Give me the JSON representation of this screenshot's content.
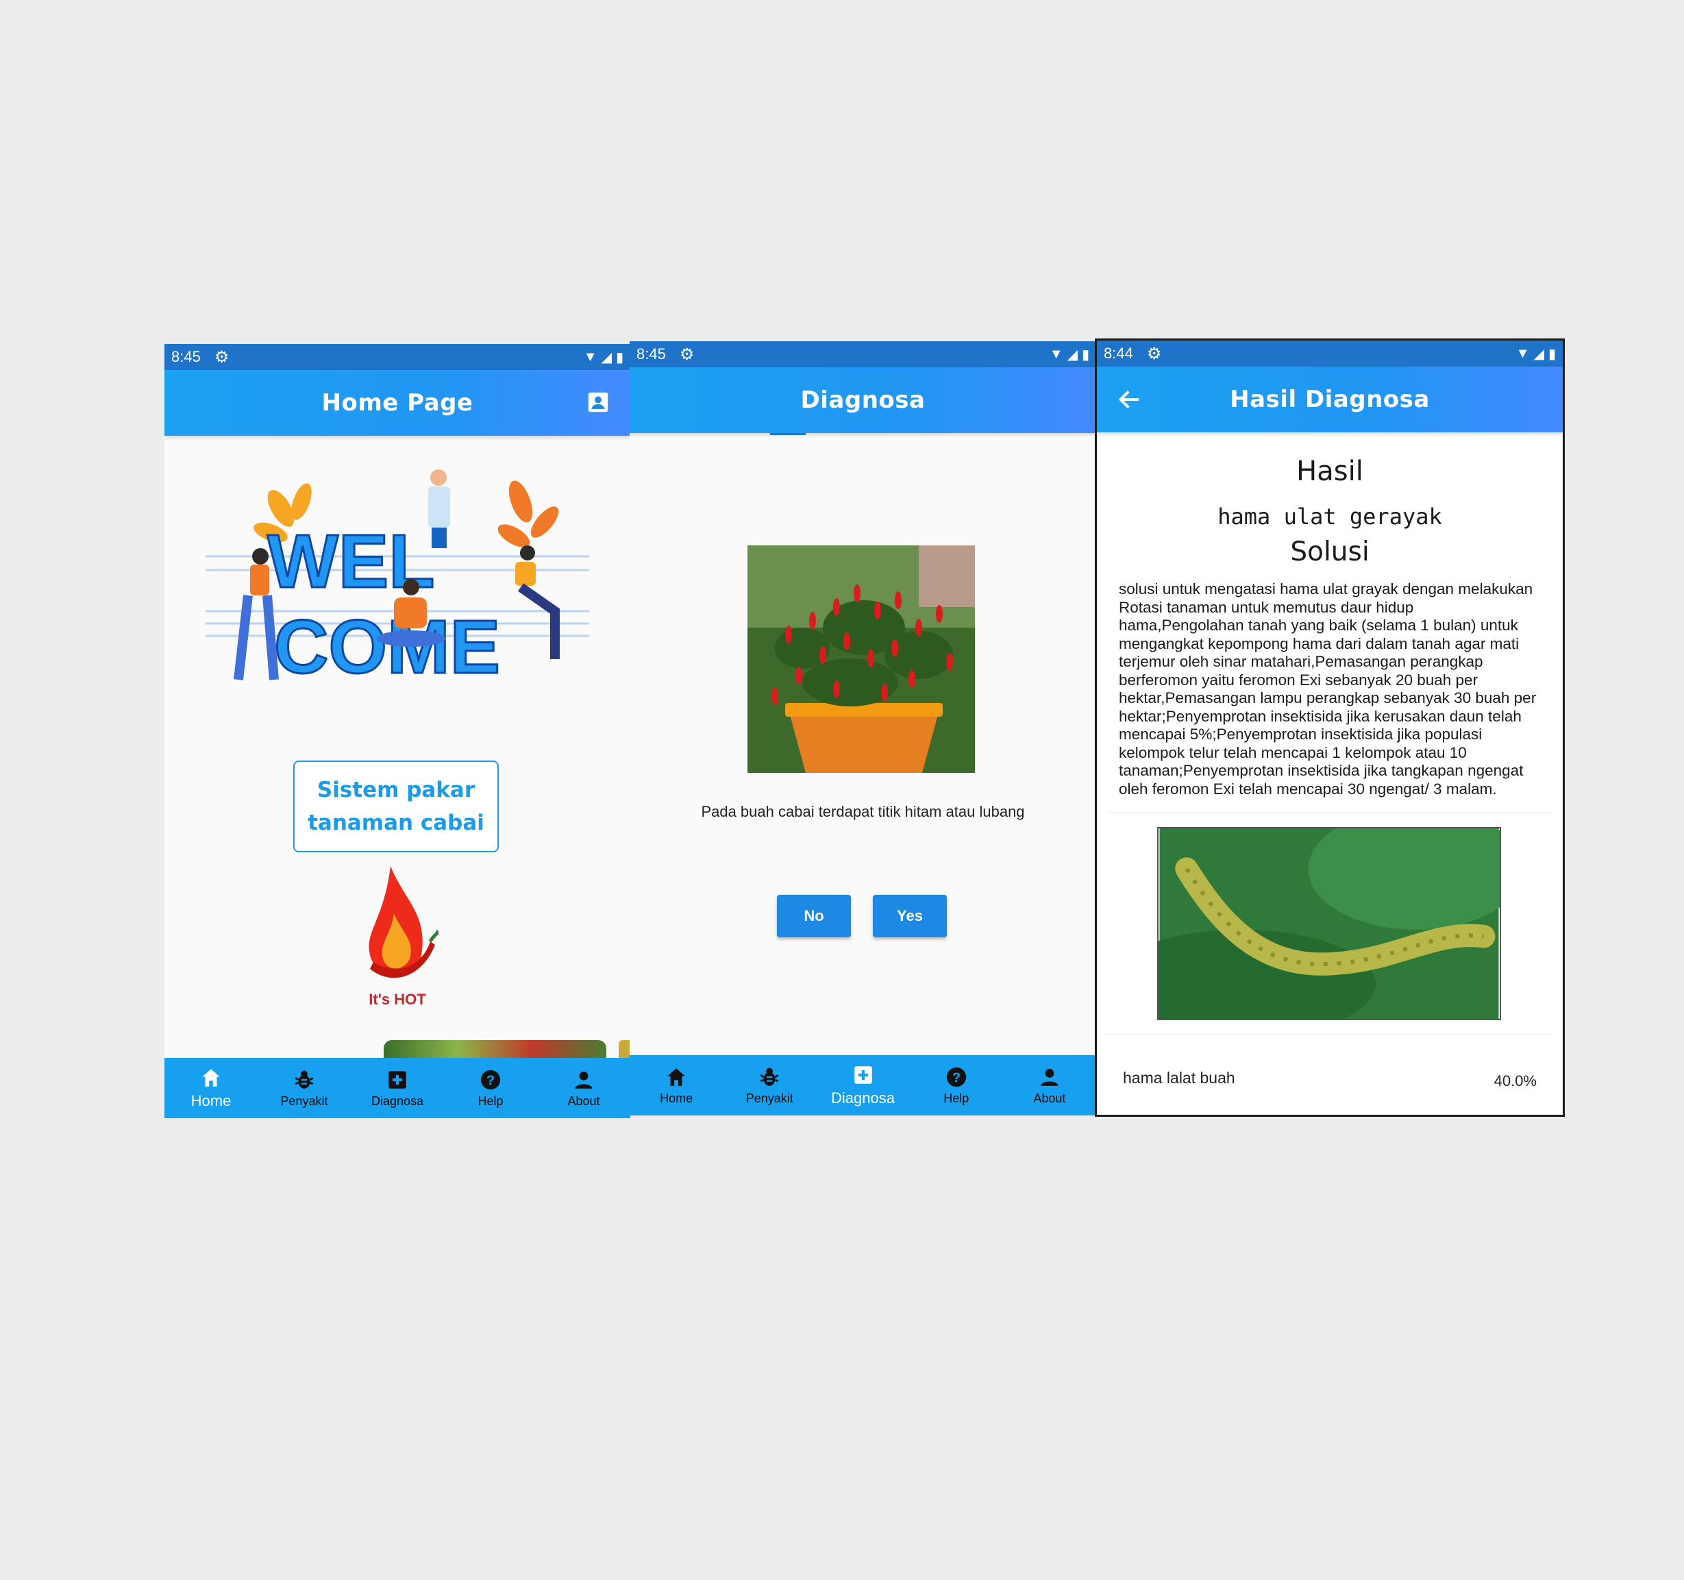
{
  "colors": {
    "appbar": "#2196f3",
    "statusbar": "#1f73c9",
    "navbar": "#18a0f0",
    "button": "#1e88e5",
    "accent_text": "#1b9be8"
  },
  "nav_items": [
    {
      "label": "Home",
      "icon": "home-icon"
    },
    {
      "label": "Penyakit",
      "icon": "bug-icon"
    },
    {
      "label": "Diagnosa",
      "icon": "medical-plus-icon"
    },
    {
      "label": "Help",
      "icon": "help-icon"
    },
    {
      "label": "About",
      "icon": "person-icon"
    }
  ],
  "home": {
    "status_time": "8:45",
    "title": "Home Page",
    "welcome_line1": "WEL",
    "welcome_line2": "COME",
    "pakar_line1": "Sistem pakar",
    "pakar_line2": "tanaman cabai",
    "hot_text": "It's HOT",
    "active_nav": "Home"
  },
  "diagnosa": {
    "status_time": "8:45",
    "title": "Diagnosa",
    "question": "Pada buah cabai terdapat titik hitam atau lubang",
    "no_label": "No",
    "yes_label": "Yes",
    "active_nav": "Diagnosa"
  },
  "result": {
    "status_time": "8:44",
    "title": "Hasil Diagnosa",
    "hasil_heading": "Hasil",
    "disease_name": "hama ulat gerayak",
    "solusi_heading": "Solusi",
    "solusi_text": "solusi untuk mengatasi hama ulat grayak dengan melakukan Rotasi tanaman untuk memutus daur hidup hama,Pengolahan tanah yang baik (selama 1 bulan) untuk mengangkat kepompong hama dari dalam tanah agar mati terjemur oleh sinar matahari,Pemasangan perangkap berferomon yaitu feromon Exi sebanyak 20 buah per hektar,Pemasangan lampu perangkap sebanyak 30 buah per hektar;Penyemprotan insektisida jika kerusakan daun telah mencapai 5%;Penyemprotan insektisida jika populasi kelompok telur telah mencapai 1 kelompok atau 10 tanaman;Penyemprotan insektisida jika tangkapan ngengat oleh feromon Exi telah mencapai 30 ngengat/ 3 malam.",
    "other_name": "hama lalat buah",
    "other_percent": "40.0%"
  }
}
